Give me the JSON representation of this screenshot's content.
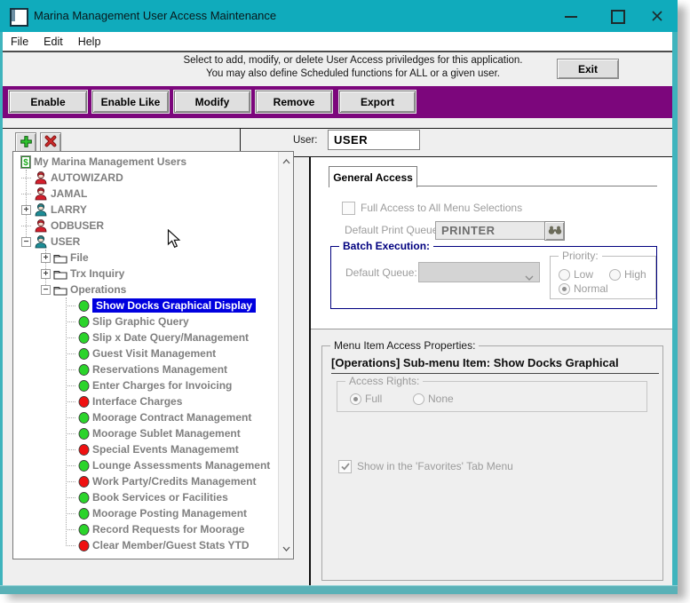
{
  "window": {
    "title": "Marina Management User Access Maintenance"
  },
  "menu_bar": [
    "File",
    "Edit",
    "Help"
  ],
  "header": {
    "line1": "Select to add, modify, or delete User Access priviledges for this application.",
    "line2": "You may also define Scheduled functions for ALL or a given user.",
    "exit_label": "Exit"
  },
  "toolbar": {
    "buttons": [
      "Enable",
      "Enable Like",
      "Modify",
      "Remove",
      "Export"
    ]
  },
  "user_bar": {
    "label": "User:",
    "value": "USER"
  },
  "tree": {
    "rows": [
      {
        "label": "My Marina Management Users",
        "icon": "dollar",
        "level": 0,
        "expand": "none",
        "selected": false
      },
      {
        "label": "AUTOWIZARD",
        "icon": "user-red",
        "level": 1,
        "expand": "none",
        "selected": false
      },
      {
        "label": "JAMAL",
        "icon": "user-red",
        "level": 1,
        "expand": "none",
        "selected": false
      },
      {
        "label": "LARRY",
        "icon": "user-teal",
        "level": 1,
        "expand": "plus",
        "selected": false
      },
      {
        "label": "ODBUSER",
        "icon": "user-red",
        "level": 1,
        "expand": "none",
        "selected": false
      },
      {
        "label": "USER",
        "icon": "user-teal",
        "level": 1,
        "expand": "minus",
        "selected": false
      },
      {
        "label": "File",
        "icon": "folder",
        "level": 2,
        "expand": "plus",
        "selected": false
      },
      {
        "label": "Trx Inquiry",
        "icon": "folder",
        "level": 2,
        "expand": "plus",
        "selected": false
      },
      {
        "label": "Operations",
        "icon": "folder",
        "level": 2,
        "expand": "minus",
        "selected": false
      },
      {
        "label": "Show Docks Graphical Display",
        "icon": "dot-green",
        "level": 3,
        "expand": "none",
        "selected": true
      },
      {
        "label": "Slip Graphic Query",
        "icon": "dot-green",
        "level": 3,
        "expand": "none",
        "selected": false
      },
      {
        "label": "Slip x Date Query/Management",
        "icon": "dot-green",
        "level": 3,
        "expand": "none",
        "selected": false
      },
      {
        "label": "Guest Visit Management",
        "icon": "dot-green",
        "level": 3,
        "expand": "none",
        "selected": false
      },
      {
        "label": "Reservations Management",
        "icon": "dot-green",
        "level": 3,
        "expand": "none",
        "selected": false
      },
      {
        "label": "Enter Charges for Invoicing",
        "icon": "dot-green",
        "level": 3,
        "expand": "none",
        "selected": false
      },
      {
        "label": "Interface Charges",
        "icon": "dot-red",
        "level": 3,
        "expand": "none",
        "selected": false
      },
      {
        "label": "Moorage Contract Management",
        "icon": "dot-green",
        "level": 3,
        "expand": "none",
        "selected": false
      },
      {
        "label": "Moorage Sublet Management",
        "icon": "dot-green",
        "level": 3,
        "expand": "none",
        "selected": false
      },
      {
        "label": "Special Events Managememt",
        "icon": "dot-red",
        "level": 3,
        "expand": "none",
        "selected": false
      },
      {
        "label": "Lounge Assessments Management",
        "icon": "dot-green",
        "level": 3,
        "expand": "none",
        "selected": false
      },
      {
        "label": "Work Party/Credits Management",
        "icon": "dot-red",
        "level": 3,
        "expand": "none",
        "selected": false
      },
      {
        "label": "Book Services or Facilities",
        "icon": "dot-green",
        "level": 3,
        "expand": "none",
        "selected": false
      },
      {
        "label": "Moorage Posting Management",
        "icon": "dot-green",
        "level": 3,
        "expand": "none",
        "selected": false
      },
      {
        "label": "Record Requests for Moorage",
        "icon": "dot-green",
        "level": 3,
        "expand": "none",
        "selected": false
      },
      {
        "label": "Clear Member/Guest Stats YTD",
        "icon": "dot-red",
        "level": 3,
        "expand": "none",
        "selected": false
      }
    ]
  },
  "general_access": {
    "tab_label": "General Access",
    "full_access_label": "Full Access to All Menu Selections",
    "full_access_checked": false,
    "print_queue_label": "Default Print Queue:",
    "print_queue_value": "PRINTER",
    "batch_group_label": "Batch Execution:",
    "default_queue_label": "Default Queue:",
    "default_queue_value": "",
    "priority_group_label": "Priority:",
    "priority_options": {
      "low": "Low",
      "high": "High",
      "normal": "Normal"
    },
    "priority_selected": "Normal"
  },
  "menu_item_props": {
    "group_label": "Menu Item Access Properties:",
    "heading": "[Operations] Sub-menu Item: Show Docks Graphical",
    "access_rights_label": "Access Rights:",
    "access_options": {
      "full": "Full",
      "none": "None"
    },
    "access_selected": "Full",
    "favorites_label": "Show in the 'Favorites' Tab Menu",
    "favorites_checked": true
  },
  "colors": {
    "titlebar_teal": "#10abbc",
    "border_teal": "#3fb4bd",
    "accent_purple": "#7c067c",
    "selection_blue": "#0000df",
    "enabled_dot_green": "#2bd42b",
    "disabled_dot_red": "#ef1111",
    "group_navy": "#00007f"
  }
}
